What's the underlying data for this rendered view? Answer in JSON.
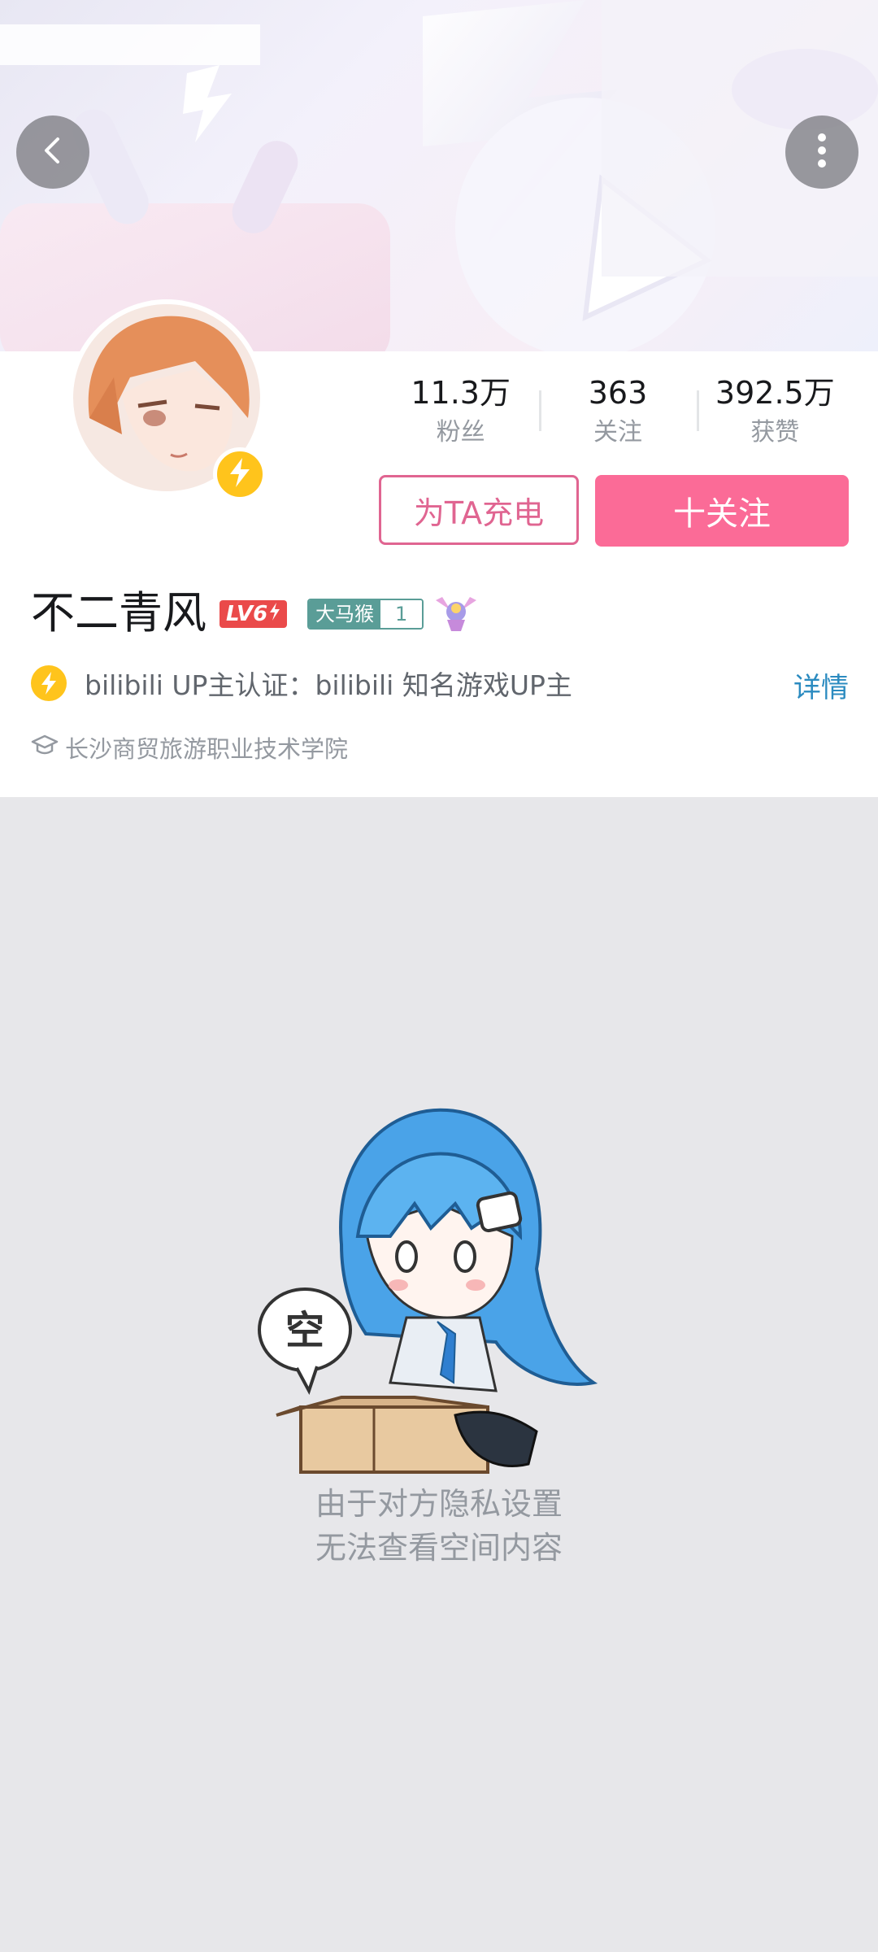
{
  "header": {
    "back_icon": "chevron-left-icon",
    "more_icon": "more-vertical-icon"
  },
  "profile": {
    "name": "不二青风",
    "level_badge": "LV6",
    "fan_medal": {
      "name": "大马猴",
      "level": "1"
    },
    "verification": "bilibili UP主认证：bilibili 知名游戏UP主",
    "detail_link": "详情",
    "school": "长沙商贸旅游职业技术学院"
  },
  "stats": [
    {
      "value": "11.3万",
      "label": "粉丝"
    },
    {
      "value": "363",
      "label": "关注"
    },
    {
      "value": "392.5万",
      "label": "获赞"
    }
  ],
  "actions": {
    "charge": "为TA充电",
    "follow": "十关注"
  },
  "empty_state": {
    "bubble_text": "空",
    "line1": "由于对方隐私设置",
    "line2": "无法查看空间内容"
  },
  "colors": {
    "brand_pink": "#fb6b97",
    "charge_pink": "#e06591",
    "bolt_yellow": "#ffc41c",
    "link_blue": "#2b8bc0"
  }
}
